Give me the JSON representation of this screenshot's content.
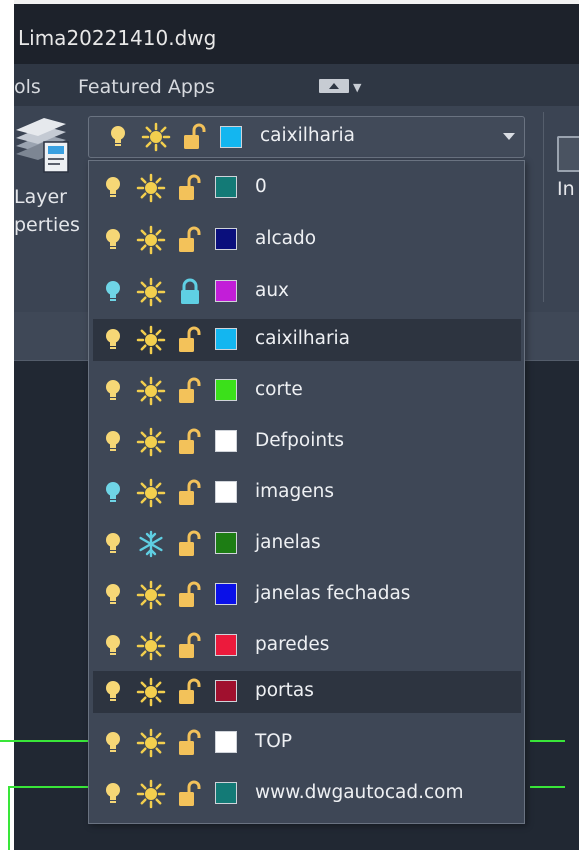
{
  "window": {
    "title": "Lima20221410.dwg"
  },
  "menubar": {
    "items": [
      "ols",
      "Featured Apps"
    ]
  },
  "ribbon": {
    "layer_properties_label_line1": "Layer",
    "layer_properties_label_line2": "perties",
    "right_partial_label": "In"
  },
  "layer_combo": {
    "current": {
      "name": "caixilharia",
      "color": "#13b6f0",
      "bulb_on": true,
      "frozen": false,
      "locked": false
    }
  },
  "layers": [
    {
      "name": "0",
      "color": "#137a76",
      "bulb_on": true,
      "frozen": false,
      "locked": false,
      "highlighted": false
    },
    {
      "name": "alcado",
      "color": "#0a0f7c",
      "bulb_on": true,
      "frozen": false,
      "locked": false,
      "highlighted": false
    },
    {
      "name": "aux",
      "color": "#c21ed8",
      "bulb_on": false,
      "frozen": false,
      "locked": true,
      "highlighted": false
    },
    {
      "name": "caixilharia",
      "color": "#13b6f0",
      "bulb_on": true,
      "frozen": false,
      "locked": false,
      "highlighted": true
    },
    {
      "name": "corte",
      "color": "#3be01a",
      "bulb_on": true,
      "frozen": false,
      "locked": false,
      "highlighted": false
    },
    {
      "name": "Defpoints",
      "color": "#ffffff",
      "bulb_on": true,
      "frozen": false,
      "locked": false,
      "highlighted": false
    },
    {
      "name": "imagens",
      "color": "#ffffff",
      "bulb_on": false,
      "frozen": false,
      "locked": false,
      "highlighted": false
    },
    {
      "name": "janelas",
      "color": "#1d7d14",
      "bulb_on": true,
      "frozen": true,
      "locked": false,
      "highlighted": false
    },
    {
      "name": "janelas fechadas",
      "color": "#0a10e8",
      "bulb_on": true,
      "frozen": false,
      "locked": false,
      "highlighted": false
    },
    {
      "name": "paredes",
      "color": "#ec1a3c",
      "bulb_on": true,
      "frozen": false,
      "locked": false,
      "highlighted": false
    },
    {
      "name": "portas",
      "color": "#a0102e",
      "bulb_on": true,
      "frozen": false,
      "locked": false,
      "highlighted": true
    },
    {
      "name": "TOP",
      "color": "#ffffff",
      "bulb_on": true,
      "frozen": false,
      "locked": false,
      "highlighted": false
    },
    {
      "name": "www.dwgautocad.com",
      "color": "#137a76",
      "bulb_on": true,
      "frozen": false,
      "locked": false,
      "highlighted": false
    }
  ],
  "icons": {
    "bulb": "lightbulb-icon",
    "sun": "sun-thaw-icon",
    "snowflake": "snowflake-freeze-icon",
    "unlock": "unlocked-padlock-icon",
    "lock": "locked-padlock-icon"
  },
  "colors": {
    "bulb_on": "#f6d776",
    "bulb_off": "#6fd5e6",
    "sun": "#f3cf4e",
    "snowflake": "#5fcfe3",
    "lock_unlocked": "#f3c25a",
    "lock_locked": "#5fcfe3",
    "cad_lines": "#39e639"
  }
}
